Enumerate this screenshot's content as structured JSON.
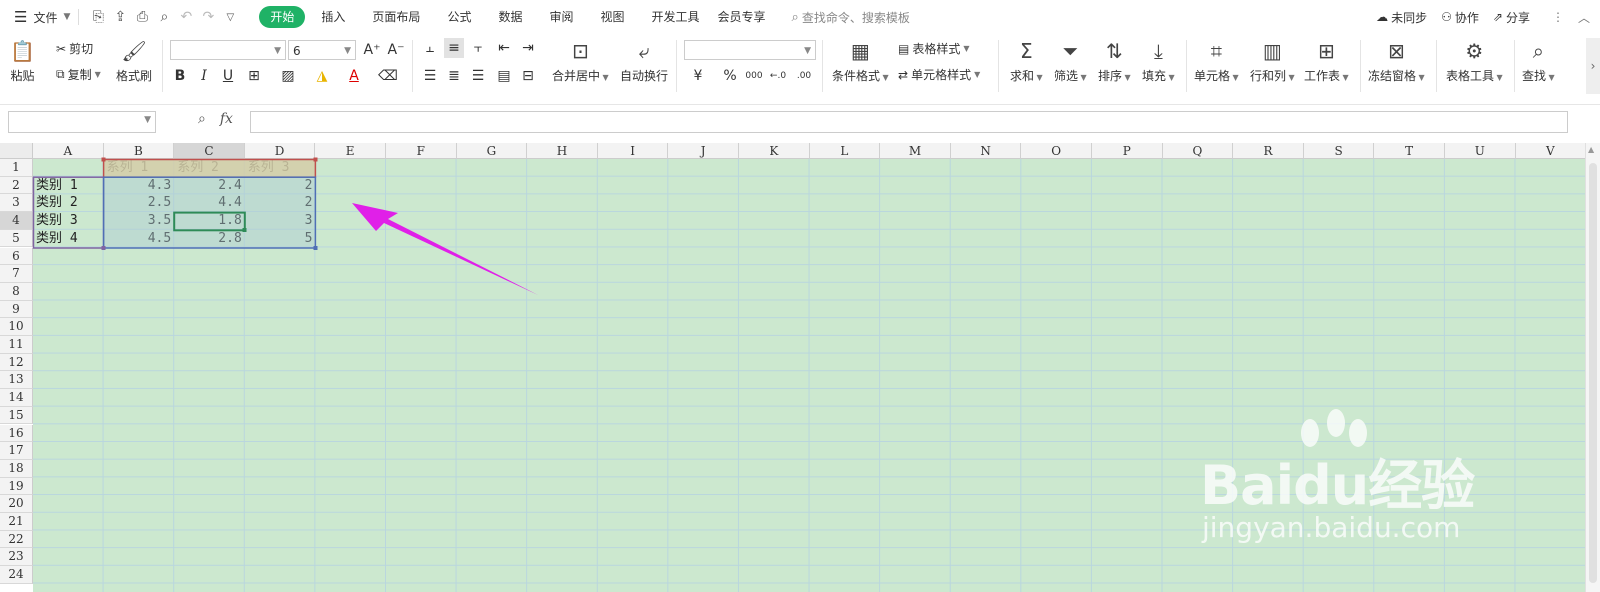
{
  "menubar": {
    "file_label": "文件",
    "tabs": [
      "开始",
      "插入",
      "页面布局",
      "公式",
      "数据",
      "审阅",
      "视图",
      "开发工具",
      "会员专享"
    ],
    "active_tab": "开始",
    "search_placeholder": "查找命令、搜索模板",
    "sync_label": "未同步",
    "collab_label": "协作",
    "share_label": "分享"
  },
  "ribbon": {
    "paste": "粘贴",
    "cut": "剪切",
    "copy": "复制",
    "format_painter": "格式刷",
    "font_name": "",
    "font_size": "6",
    "merge_center": "合并居中",
    "wrap_text": "自动换行",
    "number_format": "",
    "currency_symbol": "¥",
    "percent_symbol": "%",
    "thousands_symbol": "000",
    "cond_format": "条件格式",
    "table_style": "表格样式",
    "cell_style": "单元格样式",
    "sum": "求和",
    "filter": "筛选",
    "sort": "排序",
    "fill": "填充",
    "cell": "单元格",
    "row_col": "行和列",
    "worksheet": "工作表",
    "freeze": "冻结窗格",
    "table_tools": "表格工具",
    "find": "查找"
  },
  "formula_bar": {
    "cell_ref": "",
    "fx": "fx",
    "formula": ""
  },
  "sheet": {
    "columns": [
      "A",
      "B",
      "C",
      "D",
      "E",
      "F",
      "G",
      "H",
      "I",
      "J",
      "K",
      "L",
      "M",
      "N",
      "O",
      "P",
      "Q",
      "R",
      "S",
      "T",
      "U",
      "V"
    ],
    "rows": [
      "1",
      "2",
      "3",
      "4",
      "5",
      "6",
      "7",
      "8",
      "9",
      "10",
      "11",
      "12",
      "13",
      "14",
      "15",
      "16",
      "17",
      "18",
      "19",
      "20",
      "21",
      "22",
      "23",
      "24"
    ],
    "selected_column": "C",
    "selected_row": "4",
    "header_row": [
      "",
      "系列 1",
      "系列 2",
      "系列 3"
    ],
    "data_rows": [
      [
        "类别 1",
        "4.3",
        "2.4",
        "2"
      ],
      [
        "类别 2",
        "2.5",
        "4.4",
        "2"
      ],
      [
        "类别 3",
        "3.5",
        "1.8",
        "3"
      ],
      [
        "类别 4",
        "4.5",
        "2.8",
        "5"
      ]
    ]
  },
  "watermark": {
    "brand": "Baidu经验",
    "url": "jingyan.baidu.com"
  },
  "colors": {
    "accent": "#1fb266",
    "grid_bg": "#cce8cf",
    "arrow": "#e020e8",
    "selection": "#2e8b57"
  }
}
